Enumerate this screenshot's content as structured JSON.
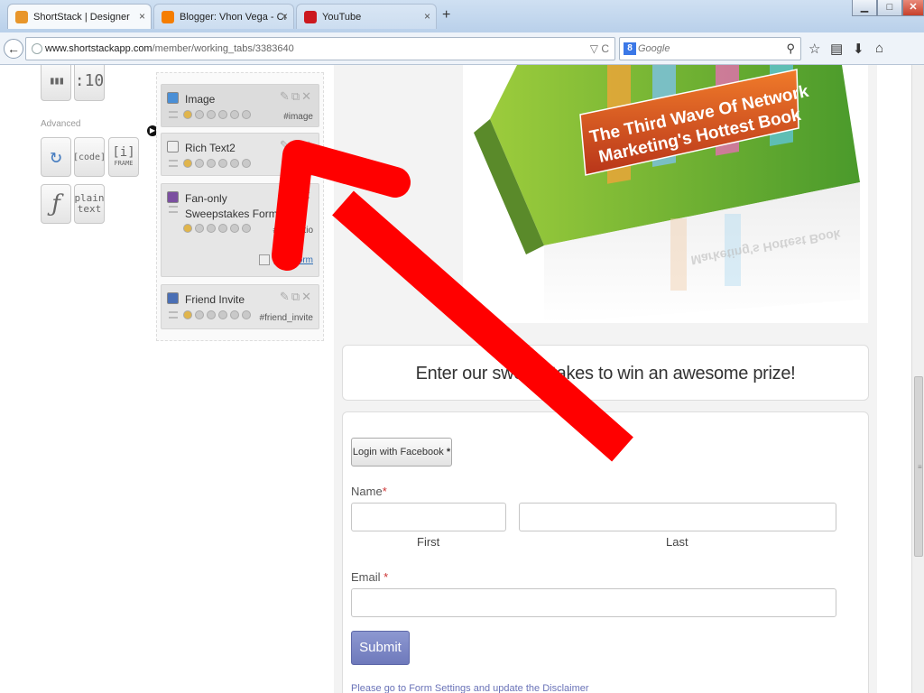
{
  "browser": {
    "tabs": [
      {
        "title": "ShortStack | Designer",
        "icon": "shortstack-icon",
        "color": "#e8962b",
        "active": true
      },
      {
        "title": "Blogger: Vhon Vega - Creat...",
        "icon": "blogger-icon",
        "color": "#f57d00",
        "active": false
      },
      {
        "title": "YouTube",
        "icon": "youtube-icon",
        "color": "#cc181e",
        "active": false
      }
    ],
    "close_glyph": "×",
    "new_tab_glyph": "+",
    "url_host": "www.shortstackapp.com",
    "url_path": "/member/working_tabs/3383640",
    "url_controls": "▽ C",
    "search_engine_letter": "8",
    "search_placeholder": "Google",
    "window_controls": {
      "minimize": "▁",
      "maximize": "□",
      "close": "✕"
    },
    "back_glyph": "←",
    "search_glyph": "⚲",
    "toolbar_glyphs": {
      "bookmark": "☆",
      "reading_list": "▤",
      "downloads": "⬇",
      "home": "⌂"
    }
  },
  "palette": {
    "top_widgets": [
      {
        "name": "chart-widget",
        "icon": "bar-chart-icon",
        "label": "▮▮▮"
      },
      {
        "name": "countdown-widget",
        "icon": "countdown-icon",
        "label": ":10"
      }
    ],
    "advanced_label": "Advanced",
    "advanced_widgets": [
      {
        "name": "refresh-widget",
        "icon": "refresh-icon",
        "label": "↻",
        "sub": ""
      },
      {
        "name": "code-widget",
        "icon": "code-icon",
        "label": "[code]",
        "sub": ""
      },
      {
        "name": "iframe-widget",
        "icon": "iframe-icon",
        "label": "[i]",
        "sub": "FRAME"
      },
      {
        "name": "flash-widget",
        "icon": "flash-icon",
        "label": "ƒ",
        "sub": ""
      },
      {
        "name": "plain-text-widget",
        "icon": "plain-text-icon",
        "label": "plain",
        "sub": "text"
      }
    ]
  },
  "panel": {
    "items": [
      {
        "title": "Image",
        "hash": "#image",
        "color": "#4a8fd6"
      },
      {
        "title": "Rich Text2",
        "hash": "#ric",
        "color": "#666666"
      },
      {
        "title": "Fan-only Sweepstakes Form",
        "hash": "#promotio",
        "color": "#7b4fa0",
        "edit_link": "Edit Form"
      },
      {
        "title": "Friend Invite",
        "hash": "#friend_invite",
        "color": "#4a6fb5"
      }
    ],
    "action_glyphs": "✎⧉✕"
  },
  "preview": {
    "cover_line1": "The Third Wave Of Network",
    "cover_line2": "Marketing's Hottest Book",
    "cover_reflection": "Marketing's Hottest Book",
    "headline": "Enter our sweepstakes to win an awesome prize!",
    "form": {
      "login_button": "Login with Facebook",
      "login_star": "*",
      "name_label": "Name",
      "required_mark": "*",
      "first_label": "First",
      "last_label": "Last",
      "email_label": "Email",
      "submit_label": "Submit",
      "disclaimer": "Please go to Form Settings and update the Disclaimer"
    }
  },
  "colors": {
    "arrow": "#ff0000",
    "submit": "#7480c2",
    "link": "#2f6fb5"
  }
}
